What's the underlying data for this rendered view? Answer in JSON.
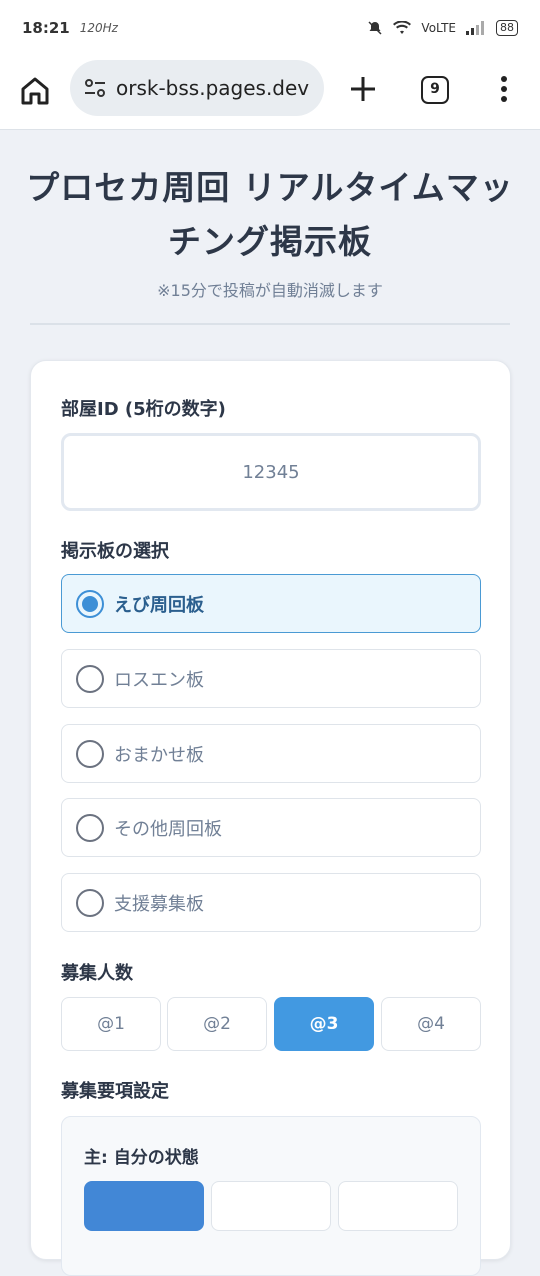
{
  "status_bar": {
    "time": "18:21",
    "refresh": "120Hz",
    "network": "VoLTE",
    "battery": "88"
  },
  "browser": {
    "url": "orsk-bss.pages.dev",
    "tab_count": "9"
  },
  "page": {
    "title": "プロセカ周回 リアルタイムマッチング掲示板",
    "subtitle": "※15分で投稿が自動消滅します"
  },
  "form": {
    "room_id_label": "部屋ID (5桁の数字)",
    "room_id_placeholder": "12345",
    "board_label": "掲示板の選択",
    "boards": [
      {
        "label": "えび周回板",
        "selected": true
      },
      {
        "label": "ロスエン板",
        "selected": false
      },
      {
        "label": "おまかせ板",
        "selected": false
      },
      {
        "label": "その他周回板",
        "selected": false
      },
      {
        "label": "支援募集板",
        "selected": false
      }
    ],
    "count_label": "募集人数",
    "counts": [
      {
        "label": "@1",
        "active": false
      },
      {
        "label": "@2",
        "active": false
      },
      {
        "label": "@3",
        "active": true
      },
      {
        "label": "@4",
        "active": false
      }
    ],
    "requirements_label": "募集要項設定",
    "host_state_label": "主: 自分の状態"
  },
  "colors": {
    "accent": "#4299e1",
    "selected_bg": "#eaf6fd",
    "text": "#2d3748"
  }
}
